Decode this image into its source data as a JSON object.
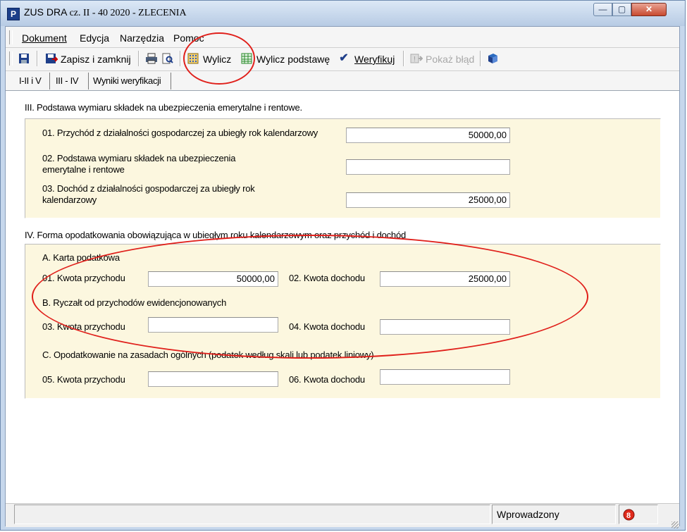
{
  "window": {
    "title_prefix": "ZUS DRA",
    "title_main": "cz. II - 40 2020 - ZLECENIA",
    "icon_letter": "P",
    "controls": {
      "minimize": "—",
      "maximize": "▢",
      "close": "✕"
    }
  },
  "menu": [
    "Dokument",
    "Edycja",
    "Narzędzia",
    "Pomoc"
  ],
  "toolbar": {
    "save_icon": "floppy-icon",
    "save_close": "Zapisz i zamknij",
    "print_icon": "printer-icon",
    "preview_icon": "preview-icon",
    "calc": "Wylicz",
    "calc_base": "Wylicz podstawę",
    "verify": "Weryfikuj",
    "show_error": "Pokaż błąd",
    "help_icon": "book-icon"
  },
  "tabs": [
    "I-II i V",
    "III - IV",
    "Wyniki weryfikacji"
  ],
  "section3": {
    "title": "III. Podstawa wymiaru składek na ubezpieczenia emerytalne i rentowe.",
    "row1_label": "01. Przychód z działalności gospodarczej za ubiegły rok kalendarzowy",
    "row1_value": "50000,00",
    "row2_label_a": "02. Podstawa wymiaru składek na ubezpieczenia",
    "row2_label_b": "emerytalne i rentowe",
    "row2_value": "",
    "row3_label_a": "03. Dochód z działalności gospodarczej za ubiegły rok",
    "row3_label_b": "kalendarzowy",
    "row3_value": "25000,00"
  },
  "section4": {
    "title": "IV. Forma opodatkowania obowiązująca w ubiegłym roku kalendarzowym oraz przychód i dochód",
    "a_title": "A. Karta podatkowa",
    "a_income_label": "01. Kwota przychodu",
    "a_income_value": "50000,00",
    "a_profit_label": "02. Kwota dochodu",
    "a_profit_value": "25000,00",
    "b_title": "B. Ryczałt od przychodów ewidencjonowanych",
    "b_income_label": "03. Kwota przychodu",
    "b_income_value": "",
    "b_profit_label": "04. Kwota dochodu",
    "b_profit_value": "",
    "c_title": "C. Opodatkowanie na zasadach ogólnych (podatek według skali lub podatek liniowy)",
    "c_income_label": "05. Kwota przychodu",
    "c_income_value": "",
    "c_profit_label": "06. Kwota dochodu",
    "c_profit_value": ""
  },
  "status": {
    "state": "Wprowadzony",
    "alert_icon": "alert-icon"
  },
  "colors": {
    "panel_bg": "#fcf7df",
    "annotation_red": "#e0201b",
    "title_gradient_top": "#dce8f6"
  }
}
